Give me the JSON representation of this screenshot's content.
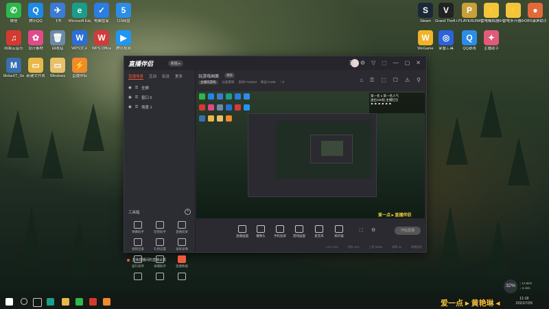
{
  "desktop": {
    "icons_left": [
      {
        "label": "微信",
        "color": "#2db84d",
        "glyph": "✆"
      },
      {
        "label": "腾讯QQ",
        "color": "#1e88e5",
        "glyph": "Q"
      },
      {
        "label": "飞书",
        "color": "#3a7bd5",
        "glyph": "✈"
      },
      {
        "label": "Microsoft Edge",
        "color": "#1a9e8a",
        "glyph": "e"
      },
      {
        "label": "电脑管家",
        "color": "#2a7de1",
        "glyph": "✓"
      },
      {
        "label": "115网盘",
        "color": "#2c8de6",
        "glyph": "5"
      },
      {
        "label": "网易云音乐",
        "color": "#d33a31",
        "glyph": "♫"
      },
      {
        "label": "设计素材",
        "color": "#e04a8a",
        "glyph": "✿"
      },
      {
        "label": "回收站",
        "color": "#6c8aa8",
        "glyph": "🗑"
      },
      {
        "label": "WPS文字",
        "color": "#2a6fd6",
        "glyph": "W"
      },
      {
        "label": "WPS Office",
        "color": "#d23b3b",
        "glyph": "W"
      },
      {
        "label": "腾讯视频",
        "color": "#2196f3",
        "glyph": "▶"
      },
      {
        "label": "MobaXT_Se",
        "color": "#3a6fb0",
        "glyph": "M"
      },
      {
        "label": "新建文件夹",
        "color": "#e8b84a",
        "glyph": "▭"
      },
      {
        "label": "Windows",
        "color": "#e8c06a",
        "glyph": "▭"
      },
      {
        "label": "直播伴侣",
        "color": "#f08a2c",
        "glyph": "⚡"
      }
    ],
    "icons_right": [
      {
        "label": "Steam",
        "color": "#1b2838",
        "glyph": "S"
      },
      {
        "label": "Grand Theft Auto V",
        "color": "#222222",
        "glyph": "V"
      },
      {
        "label": "PLAYERUNKNOWN'S BATTLEGR...",
        "color": "#c8a03a",
        "glyph": "P"
      },
      {
        "label": "雷电模拟器64",
        "color": "#f2c53d",
        "glyph": "⚡"
      },
      {
        "label": "雷电多开器64",
        "color": "#f2c53d",
        "glyph": "⚡"
      },
      {
        "label": "OBS录屏助手",
        "color": "#e26a3a",
        "glyph": "●"
      },
      {
        "label": "WeGame",
        "color": "#f0b429",
        "glyph": "W"
      },
      {
        "label": "掌盟工具",
        "color": "#2b64d6",
        "glyph": "◎"
      },
      {
        "label": "QQ游戏",
        "color": "#2b8de6",
        "glyph": "Q"
      },
      {
        "label": "主播助手",
        "color": "#e25a7a",
        "glyph": "✦"
      }
    ]
  },
  "app": {
    "title": "直播伴侣",
    "title_pill": "新版 ▸",
    "title_icons": [
      "☰",
      "⚙",
      "▽",
      "⬚",
      "—",
      "▢",
      "✕"
    ],
    "left_tabs": [
      "直播场景",
      "互动",
      "玩法",
      "更多"
    ],
    "scenes": [
      {
        "label": "全屏"
      },
      {
        "label": "窗口 5"
      },
      {
        "label": "场景 1"
      }
    ],
    "tools_title": "工具箱",
    "tools": [
      {
        "label": "弹幕助手",
        "active": false
      },
      {
        "label": "房管助手",
        "active": false
      },
      {
        "label": "直播投屏",
        "active": false
      },
      {
        "label": "视频连麦",
        "active": false
      },
      {
        "label": "礼物设置",
        "active": false
      },
      {
        "label": "录屏录像",
        "active": false
      },
      {
        "label": "送礼榜单",
        "active": false
      },
      {
        "label": "录播助手",
        "active": false
      },
      {
        "label": "直播数据",
        "active": true
      },
      {
        "label": "",
        "active": false
      },
      {
        "label": "",
        "active": false
      },
      {
        "label": "",
        "active": false
      }
    ],
    "notice": "主播直播间的直播设置",
    "room": {
      "title": "玩游戏画面",
      "badge": "横版",
      "sub_tags": [
        "主播玩游戏",
        "分类游戏",
        "房间7726533",
        "粉丝71495",
        "♡0"
      ],
      "icons": [
        "⌂",
        "⚿",
        "⬚",
        "☐",
        "⚠",
        "⚲"
      ]
    },
    "preview": {
      "rank_lines": [
        "第一名 1 第一名人气",
        "送出100钻 主播红包",
        "⚑ ⚑ ⚑ ⚑ ⚑ ⚑"
      ],
      "watermark": "爱一点 ▸ 直播伴侣"
    },
    "controls": [
      {
        "label": "直播画面"
      },
      {
        "label": "摄像头"
      },
      {
        "label": "手机投屏"
      },
      {
        "label": "游戏画面"
      },
      {
        "label": "麦克风"
      },
      {
        "label": "扬声器"
      }
    ],
    "control_icons_right": [
      "⬚",
      "⚙"
    ],
    "start_label": "开始直播",
    "status": [
      "CPU 23%",
      "内存 45%",
      "上传 0KB/s",
      "帧率 60",
      "网络良好"
    ]
  },
  "taskbar": {
    "icons": [
      {
        "name": "start",
        "color": "#ffffff"
      },
      {
        "name": "search",
        "color": "#cccccc"
      },
      {
        "name": "task-view",
        "color": "#cccccc"
      },
      {
        "name": "edge",
        "color": "#1a9e8a"
      },
      {
        "name": "explorer",
        "color": "#e8b84a"
      },
      {
        "name": "wechat",
        "color": "#2db84d"
      },
      {
        "name": "netease",
        "color": "#d33a31"
      },
      {
        "name": "zhibo",
        "color": "#f08a2c"
      }
    ],
    "time": "11:18",
    "date": "2021/7/25",
    "speed_pct": "32%",
    "speed_up": "↑ 12.6k/s",
    "speed_down": "↓ 3.1k/s",
    "brand": "爱一点 ▸ 黄艳琳 ◂"
  }
}
